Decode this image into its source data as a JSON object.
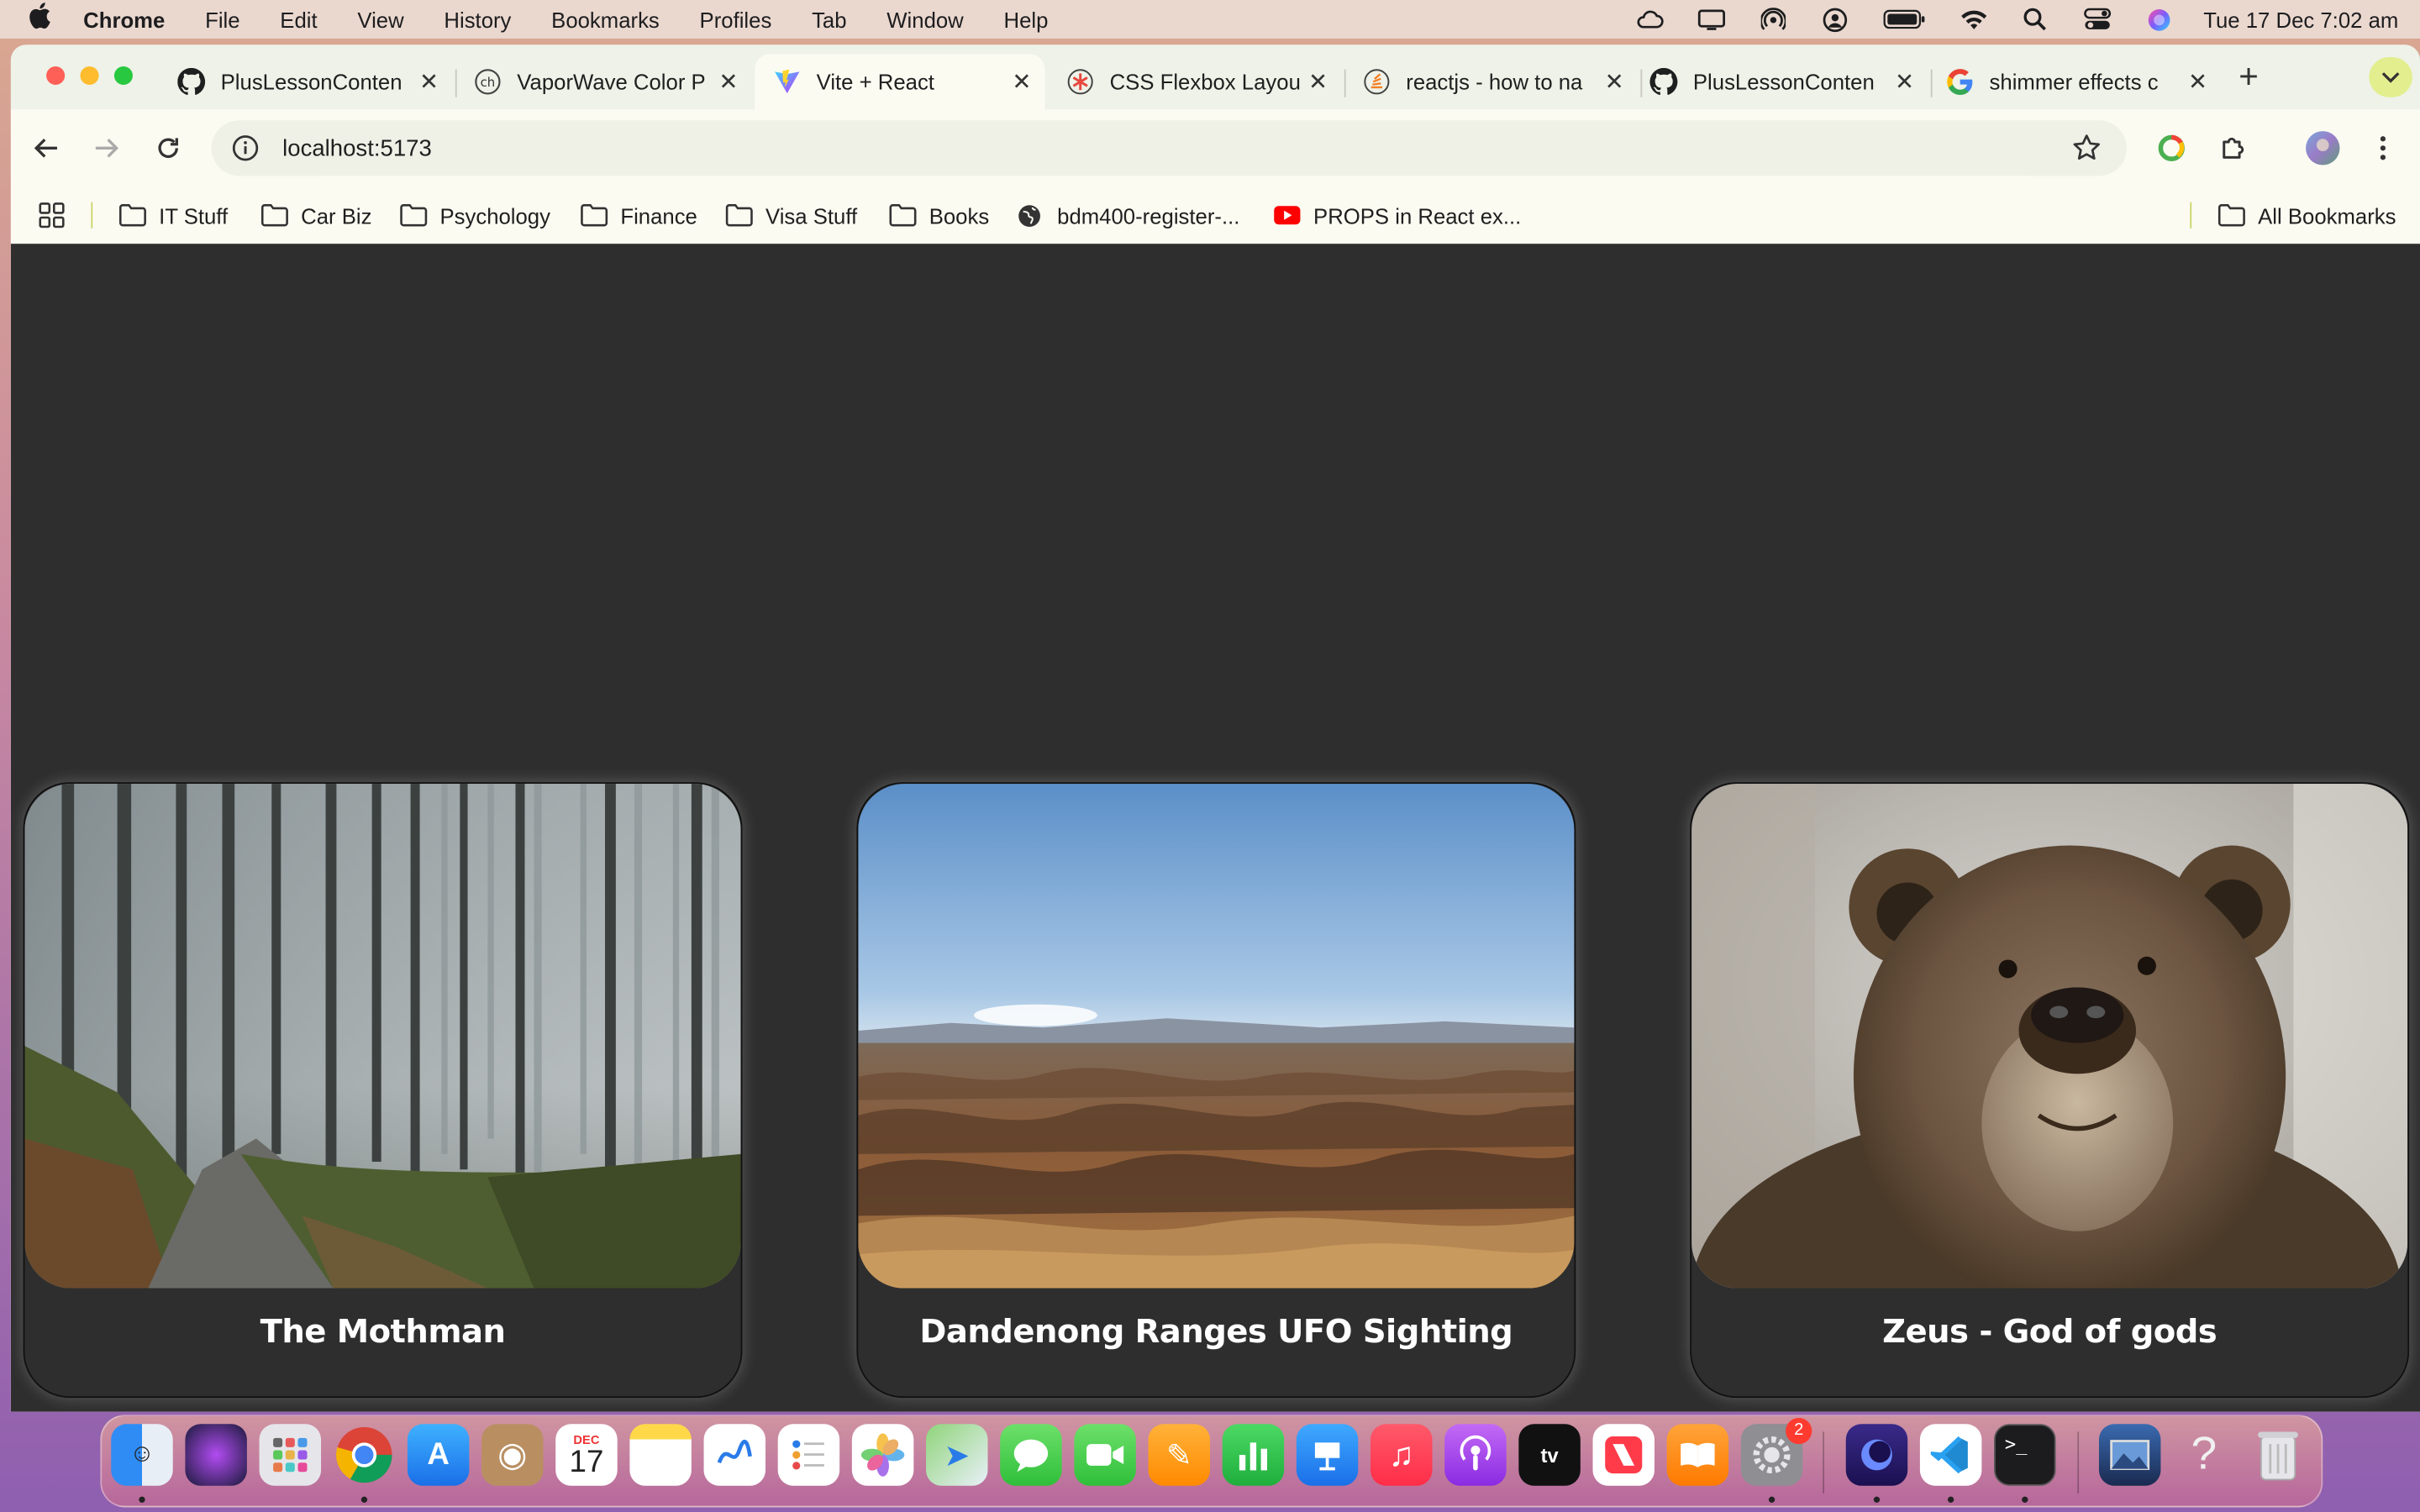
{
  "menubar": {
    "app_name": "Chrome",
    "items": [
      "File",
      "Edit",
      "View",
      "History",
      "Bookmarks",
      "Profiles",
      "Tab",
      "Window",
      "Help"
    ],
    "clock": "Tue 17 Dec  7:02 am"
  },
  "tabs": [
    {
      "title": "PlusLessonConten",
      "icon": "github-icon",
      "active": false
    },
    {
      "title": "VaporWave Color P",
      "icon": "coolhue-icon",
      "active": false
    },
    {
      "title": "Vite + React",
      "icon": "vite-icon",
      "active": true
    },
    {
      "title": "CSS Flexbox Layou",
      "icon": "css-tricks-icon",
      "active": false
    },
    {
      "title": "reactjs - how to na",
      "icon": "stackoverflow-icon",
      "active": false
    },
    {
      "title": "PlusLessonConten",
      "icon": "github-icon",
      "active": false
    },
    {
      "title": "shimmer effects c",
      "icon": "google-icon",
      "active": false
    }
  ],
  "toolbar": {
    "url": "localhost:5173"
  },
  "bookmarks": [
    {
      "label": "IT Stuff",
      "icon": "folder-icon"
    },
    {
      "label": "Car Biz",
      "icon": "folder-icon"
    },
    {
      "label": "Psychology",
      "icon": "folder-icon"
    },
    {
      "label": "Finance",
      "icon": "folder-icon"
    },
    {
      "label": "Visa Stuff",
      "icon": "folder-icon"
    },
    {
      "label": "Books",
      "icon": "folder-icon"
    },
    {
      "label": "bdm400-register-...",
      "icon": "globe-icon"
    },
    {
      "label": "PROPS in React ex...",
      "icon": "youtube-icon"
    }
  ],
  "all_bookmarks": "All Bookmarks",
  "cards": [
    {
      "title": "The Mothman",
      "image": "foggy-forest-path"
    },
    {
      "title": "Dandenong Ranges UFO Sighting",
      "image": "rolling-hills-landscape"
    },
    {
      "title": "Zeus - God of gods",
      "image": "brown-bear-portrait"
    }
  ],
  "dock": {
    "apps": [
      "finder",
      "siri",
      "launchpad",
      "chrome",
      "app-store",
      "contacts",
      "calendar",
      "notes",
      "freeform",
      "reminders",
      "photos",
      "maps",
      "messages",
      "facetime",
      "pages",
      "numbers",
      "keynote",
      "music",
      "podcasts",
      "apple-tv",
      "news",
      "books",
      "system-settings",
      "screen-recorder",
      "vscode",
      "terminal",
      "preview",
      "help",
      "trash"
    ],
    "calendar_month": "DEC",
    "calendar_day": "17",
    "settings_badge": "2"
  },
  "colors": {
    "page_background": "#2e2e2e",
    "card_title": "#ffffff",
    "accent_tab_menu": "#e3ef8f"
  }
}
